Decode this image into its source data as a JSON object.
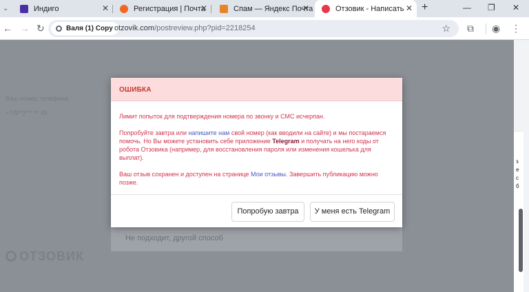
{
  "browser": {
    "tabs": [
      {
        "title": "Индиго",
        "favicon_color": "#4b2ea3",
        "active": false
      },
      {
        "title": "Регистрация | Почта",
        "favicon_color": "#f26522",
        "active": false
      },
      {
        "title": "Спам — Яндекс Почта",
        "favicon_color": "#e8832a",
        "active": false
      },
      {
        "title": "Отзовик - Написать отзыв",
        "favicon_color": "#e8364c",
        "active": true
      }
    ],
    "new_tab_icon": "plus-icon",
    "profile_chip": "Валя (1) Copy",
    "url_host": "otzovik.com",
    "url_path": "/postreview.php?pid=2218254"
  },
  "page": {
    "background_text_label": "Ваш номер телефона",
    "background_text_value": "+7(9**)*** ** 48",
    "background_box_text": "Не подходит, другой способ",
    "logo_text": "ОТЗОВИК",
    "right_edge_text": [
      "з",
      "е",
      "с",
      "б"
    ]
  },
  "modal": {
    "title": "ОШИБКА",
    "line1": "Лимит попыток для подтверждения номера по звонку и СМС исчерпан.",
    "p2_a": "Попробуйте завтра или ",
    "p2_link": "напишите нам",
    "p2_b": " свой номер (как вводили на сайте) и мы постараемся помочь. Но Вы можете установить себе приложение ",
    "p2_bold": "Telegram",
    "p2_c": " и получать на него коды от робота Отзовика (например, для восстановления пароля или изменения кошелька для выплат).",
    "p3_a": "Ваш отзыв сохранен и доступен на странице ",
    "p3_link": "Мои отзывы",
    "p3_b": ". Завершить публикацию можно позже.",
    "button_tomorrow": "Попробую завтра",
    "button_telegram": "У меня есть Telegram"
  },
  "colors": {
    "header_bg": "#fcdcdc",
    "title_red": "#c0392b",
    "body_red": "#d1334f",
    "link_blue": "#4a57c5",
    "overlay": "#8a9096"
  }
}
